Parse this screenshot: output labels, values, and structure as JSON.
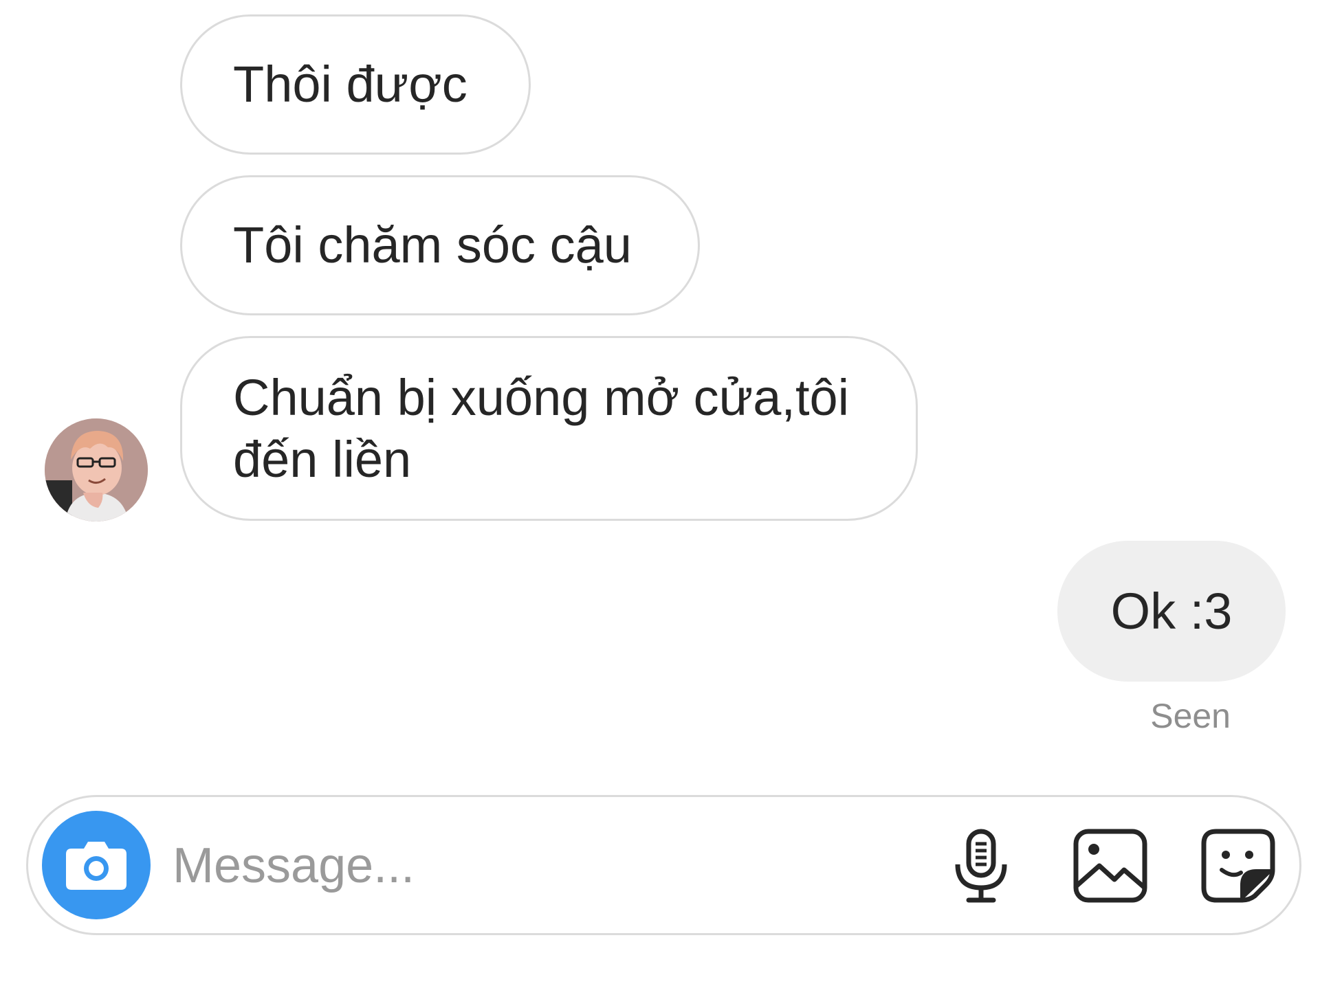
{
  "thread": {
    "incoming": [
      {
        "text": "Thôi được"
      },
      {
        "text": "Tôi chăm sóc cậu"
      },
      {
        "lines": [
          "Chuẩn bị xuống mở cửa,tôi",
          "đến liền"
        ]
      }
    ],
    "outgoing": [
      {
        "text": "Ok :3",
        "status": "Seen"
      }
    ]
  },
  "composer": {
    "placeholder": "Message...",
    "icons": {
      "camera": "camera-icon",
      "mic": "microphone-icon",
      "gallery": "image-icon",
      "sticker": "sticker-icon"
    }
  },
  "colors": {
    "accent": "#3897f0",
    "incoming_border": "#dbdbdb",
    "outgoing_bg": "#efefef",
    "text": "#262626",
    "muted": "#8e8e8e"
  }
}
